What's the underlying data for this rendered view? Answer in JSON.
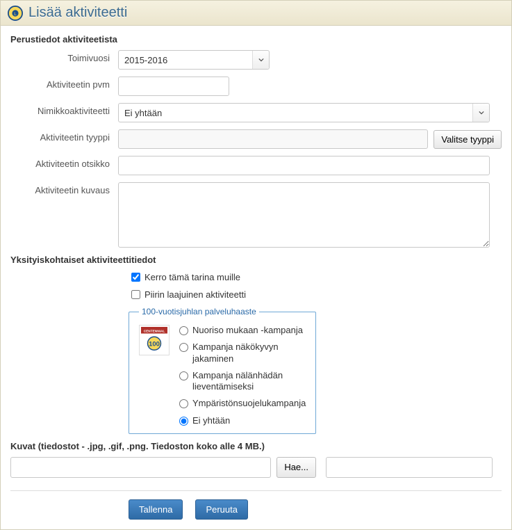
{
  "window": {
    "title": "Lisää aktiviteetti"
  },
  "section_basic": "Perustiedot aktiviteetista",
  "fields": {
    "year_label": "Toimivuosi",
    "year_value": "2015-2016",
    "date_label": "Aktiviteetin pvm",
    "date_value": "",
    "signature_label": "Nimikkoaktiviteetti",
    "signature_value": "Ei yhtään",
    "type_label": "Aktiviteetin tyyppi",
    "type_value": "",
    "type_button": "Valitse tyyppi",
    "title_label": "Aktiviteetin otsikko",
    "title_value": "",
    "desc_label": "Aktiviteetin kuvaus",
    "desc_value": ""
  },
  "section_details": "Yksityiskohtaiset aktiviteettitiedot",
  "checks": {
    "share_label": "Kerro tämä tarina muille",
    "share_checked": true,
    "district_label": "Piirin laajuinen aktiviteetti",
    "district_checked": false
  },
  "centennial": {
    "legend": "100-vuotisjuhlan palveluhaaste",
    "options": {
      "youth": "Nuoriso mukaan -kampanja",
      "vision": "Kampanja näkökyvyn jakaminen",
      "hunger": "Kampanja nälänhädän lieventämiseksi",
      "env": "Ympäristönsuojelukampanja",
      "none": "Ei yhtään"
    },
    "selected": "none"
  },
  "images": {
    "label": "Kuvat (tiedostot - .jpg, .gif, .png. Tiedoston koko alle 4 MB.)",
    "browse": "Hae..."
  },
  "actions": {
    "save": "Tallenna",
    "cancel": "Peruuta"
  }
}
